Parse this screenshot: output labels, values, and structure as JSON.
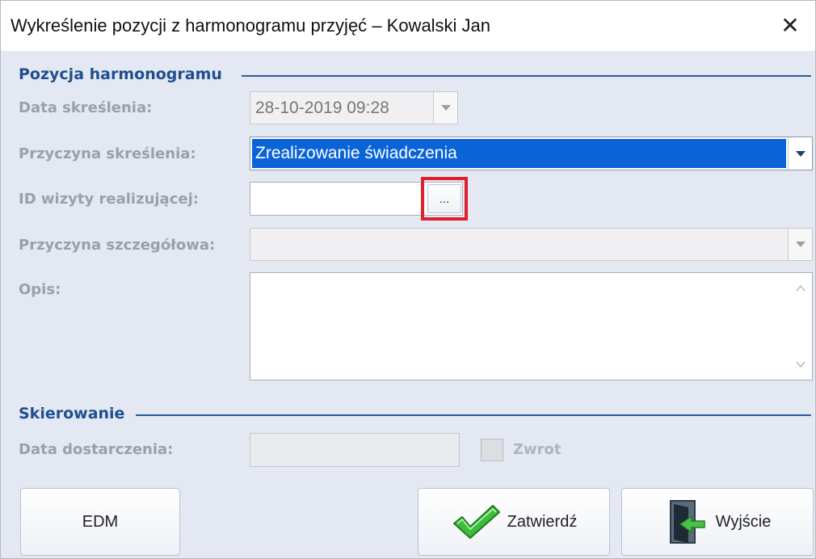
{
  "window": {
    "title": "Wykreślenie pozycji z harmonogramu przyjęć – Kowalski Jan",
    "close_glyph": "✕"
  },
  "sections": {
    "position": "Pozycja harmonogramu",
    "referral": "Skierowanie"
  },
  "labels": {
    "strike_date": "Data skreślenia:",
    "strike_reason": "Przyczyna skreślenia:",
    "visit_id": "ID wizyty realizującej:",
    "detail_reason": "Przyczyna szczegółowa:",
    "description": "Opis:",
    "delivery_date": "Data dostarczenia:"
  },
  "fields": {
    "strike_date": "28-10-2019 09:28",
    "strike_reason": "Zrealizowanie świadczenia",
    "visit_id": "",
    "detail_reason": "",
    "description": "",
    "delivery_date": ""
  },
  "visit_id_browse_label": "...",
  "return_checkbox": {
    "label": "Zwrot",
    "checked": false
  },
  "buttons": {
    "edm": "EDM",
    "confirm": "Zatwierdź",
    "exit": "Wyjście"
  },
  "colors": {
    "selection": "#0a64d8",
    "section_text": "#1f4f8f",
    "highlight_box": "#e0202a"
  }
}
